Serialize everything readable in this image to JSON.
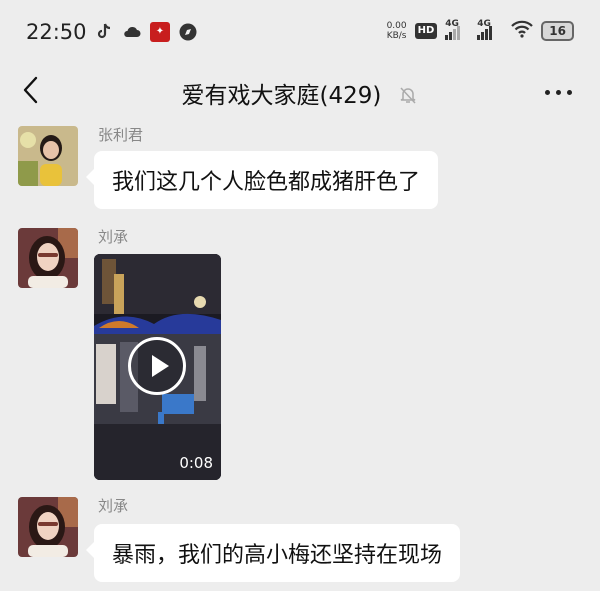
{
  "status_bar": {
    "time": "22:50",
    "speed_value": "0.00",
    "speed_unit": "KB/s",
    "hd_label": "HD",
    "hd_sub": "1 2",
    "sim1": "4G",
    "sim2": "4G",
    "battery": "16"
  },
  "header": {
    "title": "爱有戏大家庭(429)"
  },
  "messages": [
    {
      "sender": "张利君",
      "text": "我们这几个人脸色都成猪肝色了"
    },
    {
      "sender": "刘承",
      "video_duration": "0:08"
    },
    {
      "sender": "刘承",
      "text": "暴雨，我们的高小梅还坚持在现场"
    }
  ]
}
